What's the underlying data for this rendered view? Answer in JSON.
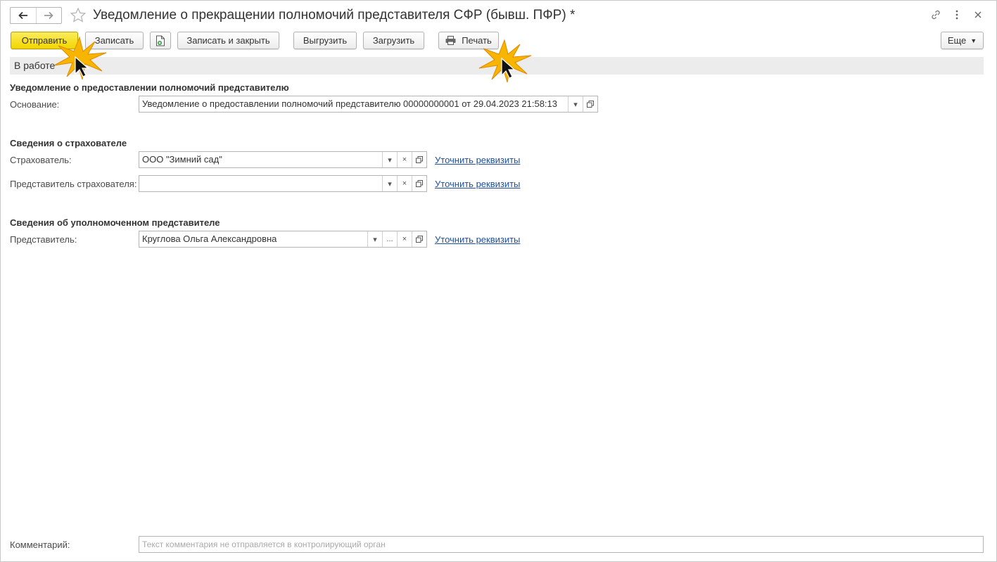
{
  "window": {
    "title": "Уведомление о прекращении полномочий представителя СФР (бывш. ПФР) *",
    "icons": [
      "arrow-left-icon",
      "arrow-right-icon",
      "star-icon",
      "link-icon",
      "more-icon",
      "close-icon"
    ]
  },
  "toolbar": {
    "send_label": "Отправить",
    "save_label": "Записать",
    "save_close_label": "Записать и закрыть",
    "export_label": "Выгрузить",
    "import_label": "Загрузить",
    "print_label": "Печать",
    "more_label": "Еще"
  },
  "status": {
    "text": "В работе"
  },
  "basis_section": {
    "title": "Уведомление о предоставлении полномочий представителю",
    "basis_label": "Основание:",
    "basis_value": "Уведомление о предоставлении полномочий представителю 00000000001 от 29.04.2023 21:58:13"
  },
  "insurer_section": {
    "title": "Сведения о страхователе",
    "insurer_label": "Страхователь:",
    "insurer_value": "ООО \"Зимний сад\"",
    "insurer_rep_label": "Представитель страхователя:",
    "insurer_rep_value": "",
    "refine_link": "Уточнить реквизиты"
  },
  "representative_section": {
    "title": "Сведения об уполномоченном представителе",
    "rep_label": "Представитель:",
    "rep_value": "Круглова Ольга Александровна",
    "refine_link": "Уточнить реквизиты"
  },
  "comment": {
    "label": "Комментарий:",
    "value": "",
    "placeholder": "Текст комментария не отправляется в контролирующий орган"
  },
  "colors": {
    "primary_button": "#f2d600",
    "link": "#1e4f9c",
    "status_strip": "#ececec"
  }
}
